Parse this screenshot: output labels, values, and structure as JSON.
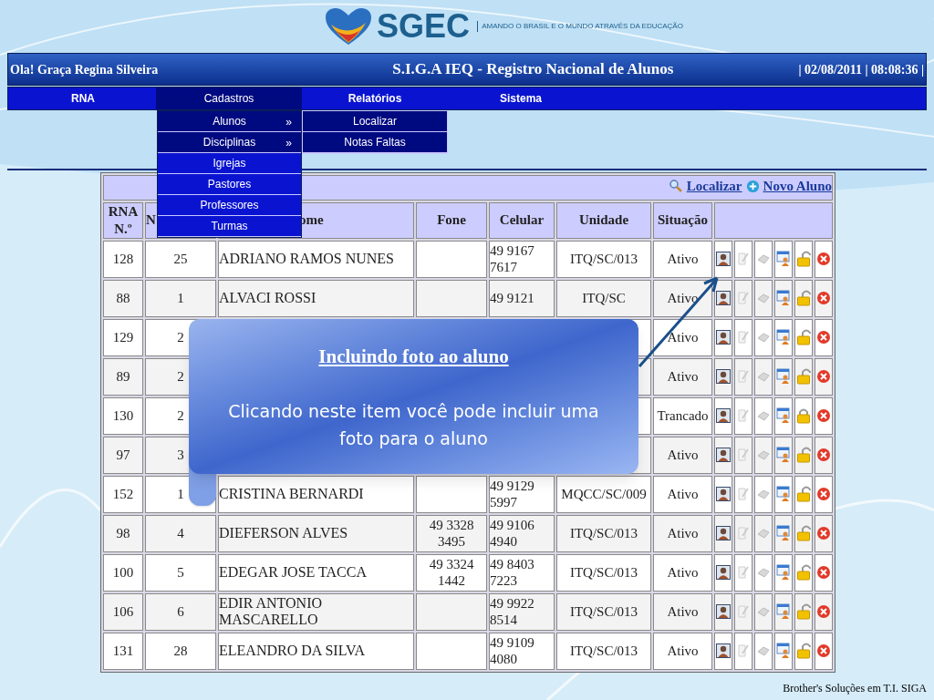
{
  "logo": {
    "name": "SGEC",
    "tagline": "AMANDO O BRASIL E O MUNDO ATRAVÉS DA EDUCAÇÃO"
  },
  "top_bar": {
    "greeting": "Ola! Graça Regina Silveira",
    "title": "S.I.G.A IEQ - Registro Nacional de Alunos",
    "datetime": "| 02/08/2011 | 08:08:36 |"
  },
  "nav": [
    {
      "label": "RNA",
      "selected": false
    },
    {
      "label": "Cadastros",
      "selected": true
    },
    {
      "label": "Relatórios",
      "selected": false
    },
    {
      "label": "Sistema",
      "selected": false
    }
  ],
  "dropdown": [
    {
      "label": "Alunos",
      "arrow": "»",
      "selected": true
    },
    {
      "label": "Disciplinas",
      "arrow": "»",
      "selected": true
    },
    {
      "label": "Igrejas",
      "selected": false
    },
    {
      "label": "Pastores",
      "selected": false
    },
    {
      "label": "Professores",
      "selected": false
    },
    {
      "label": "Turmas",
      "selected": false
    }
  ],
  "submenu": [
    {
      "label": "Localizar",
      "selected": true
    },
    {
      "label": "Notas Faltas",
      "selected": true
    }
  ],
  "toolbar": {
    "links": [
      {
        "label": "Localizar",
        "kind": "search"
      },
      {
        "label": "Novo Aluno",
        "kind": "add"
      }
    ]
  },
  "table": {
    "columns": [
      "RNA N.º",
      "N",
      "ome",
      "Fone",
      "Celular",
      "Unidade",
      "Situação"
    ],
    "rows": [
      {
        "rna": "128",
        "num": "25",
        "nome": "ADRIANO RAMOS NUNES",
        "celular": "49 9167 7617",
        "unidade": "ITQ/SC/013",
        "situacao": "Ativo",
        "locked": false
      },
      {
        "rna": "88",
        "num": "1",
        "nome": "ALVACI ROSSI",
        "celular": "49 9121",
        "unidade": "ITQ/SC",
        "situacao": "Ativo",
        "locked": false
      },
      {
        "rna": "129",
        "num": "2",
        "situacao": "Ativo",
        "locked": false
      },
      {
        "rna": "89",
        "num": "2",
        "situacao": "Ativo",
        "locked": false
      },
      {
        "rna": "130",
        "num": "2",
        "situacao": "Trancado",
        "locked": true
      },
      {
        "rna": "97",
        "num": "3",
        "situacao": "Ativo",
        "locked": false
      },
      {
        "rna": "152",
        "num": "1",
        "nome": "CRISTINA BERNARDI",
        "celular": "49 9129 5997",
        "unidade": "MQCC/SC/009",
        "situacao": "Ativo",
        "locked": false
      },
      {
        "rna": "98",
        "num": "4",
        "nome": "DIEFERSON ALVES",
        "fone": "49 3328 3495",
        "celular": "49 9106 4940",
        "unidade": "ITQ/SC/013",
        "situacao": "Ativo",
        "locked": false
      },
      {
        "rna": "100",
        "num": "5",
        "nome": "EDEGAR JOSE TACCA",
        "fone": "49 3324 1442",
        "celular": "49 8403 7223",
        "unidade": "ITQ/SC/013",
        "situacao": "Ativo",
        "locked": false
      },
      {
        "rna": "106",
        "num": "6",
        "nome": "EDIR ANTONIO MASCARELLO",
        "celular": "49 9922 8514",
        "unidade": "ITQ/SC/013",
        "situacao": "Ativo",
        "locked": false
      },
      {
        "rna": "131",
        "num": "28",
        "nome": "ELEANDRO DA SILVA",
        "celular": "49 9109 4080",
        "unidade": "ITQ/SC/013",
        "situacao": "Ativo",
        "locked": false
      }
    ]
  },
  "callout": {
    "title": "Incluindo foto ao aluno",
    "text": "Clicando neste item você pode incluir uma foto para o aluno"
  },
  "footer": "Brother's Soluções em T.I. SIGA"
}
